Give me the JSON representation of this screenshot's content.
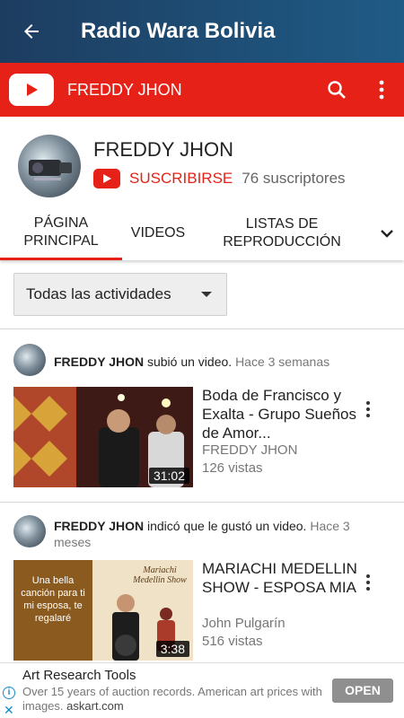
{
  "appbar": {
    "title": "Radio Wara Bolivia"
  },
  "channel_bar": {
    "channel_name": "FREDDY JHON"
  },
  "channel": {
    "name": "FREDDY JHON",
    "subscribe_label": "SUSCRIBIRSE",
    "subscribers": "76 suscriptores"
  },
  "tabs": [
    {
      "label": "PÁGINA PRINCIPAL",
      "active": true
    },
    {
      "label": "VIDEOS",
      "active": false
    },
    {
      "label": "LISTAS DE REPRODUCCIÓN",
      "active": false
    }
  ],
  "filter": {
    "selected": "Todas las actividades"
  },
  "activities": [
    {
      "user": "FREDDY JHON",
      "action": "subió un video.",
      "time": "Hace 3 semanas",
      "video": {
        "title": "Boda de Francisco y Exalta - Grupo Sueños de Amor...",
        "channel": "FREDDY JHON",
        "views": "126 vistas",
        "duration": "31:02"
      }
    },
    {
      "user": "FREDDY JHON",
      "action": "indicó que le gustó un video.",
      "time": "Hace 3 meses",
      "video": {
        "title": "MARIACHI MEDELLIN SHOW - ESPOSA MIA",
        "channel": "John Pulgarín",
        "views": "516 vistas",
        "duration": "3:38",
        "thumb_text": "Una bella canción para ti mi esposa, te regalaré",
        "thumb_logo": "Mariachi Medellin Show"
      }
    }
  ],
  "ad": {
    "headline": "Art Research Tools",
    "description": "Over 15 years of auction records. American art prices with images.",
    "domain": "askart.com",
    "cta": "OPEN"
  },
  "colors": {
    "appbar": "#1d3d60",
    "youtube_red": "#e62117"
  }
}
